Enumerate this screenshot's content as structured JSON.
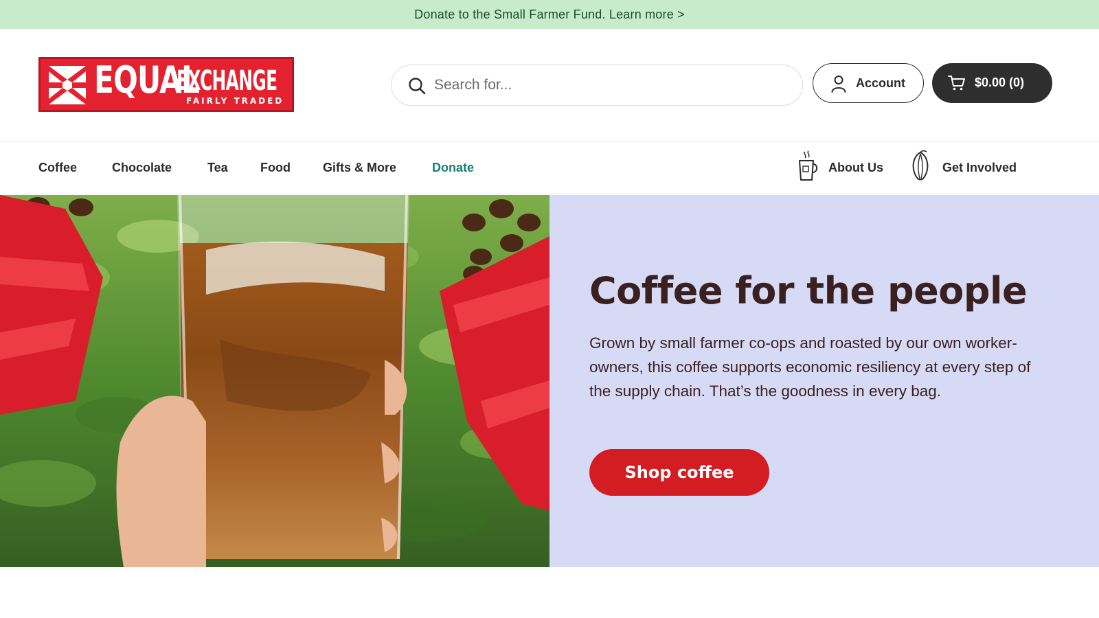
{
  "promo": {
    "text": "Donate to the Small Farmer Fund. Learn more >"
  },
  "brand": {
    "name_part1": "EQUAL",
    "name_part2": "EXCHANGE",
    "tagline": "FAIRLY TRADED",
    "color": "#e4212f"
  },
  "search": {
    "placeholder": "Search for...",
    "value": ""
  },
  "account": {
    "label": "Account"
  },
  "cart": {
    "label": "$0.00 (0)"
  },
  "nav": {
    "items": [
      {
        "label": "Coffee"
      },
      {
        "label": "Chocolate"
      },
      {
        "label": "Tea"
      },
      {
        "label": "Food"
      },
      {
        "label": "Gifts & More"
      },
      {
        "label": "Donate",
        "color": "#167f72"
      }
    ],
    "right_items": [
      {
        "label": "About Us",
        "icon": "coffee-mug-icon"
      },
      {
        "label": "Get Involved",
        "icon": "cacao-pod-icon"
      }
    ]
  },
  "hero": {
    "title": "Coffee for the people",
    "body": "Grown by small farmer co-ops and roasted by our own worker-owners, this coffee supports economic resiliency at every step of the supply chain. That’s the goodness in every bag.",
    "cta": "Shop coffee",
    "panel_color": "#d6daf5",
    "cta_color": "#d41c23"
  }
}
